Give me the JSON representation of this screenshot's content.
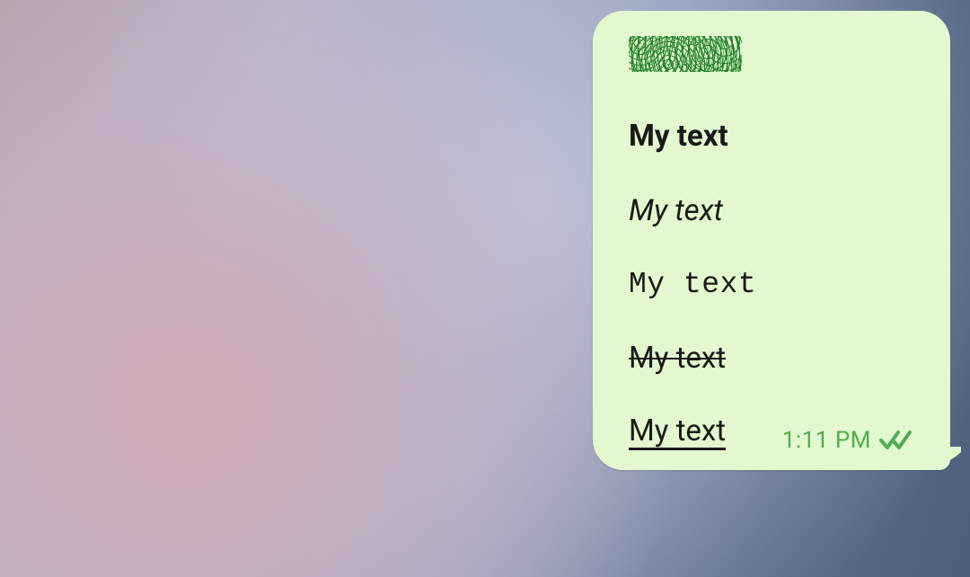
{
  "colors": {
    "bubble_bg": "#e3f8cf",
    "meta_green": "#4fae4f",
    "text": "#1a1a1a"
  },
  "chat": {
    "outgoing_bubble": {
      "lines": [
        {
          "style": "spoiler",
          "text": "My text"
        },
        {
          "style": "bold",
          "text": "My text"
        },
        {
          "style": "italic",
          "text": "My text"
        },
        {
          "style": "mono",
          "text": "My text"
        },
        {
          "style": "strike",
          "text": "My text"
        },
        {
          "style": "underline",
          "text": "My text"
        }
      ],
      "timestamp": "1:11 PM",
      "read_status": "read",
      "icons": {
        "read_ticks": "double-check-icon"
      }
    }
  }
}
